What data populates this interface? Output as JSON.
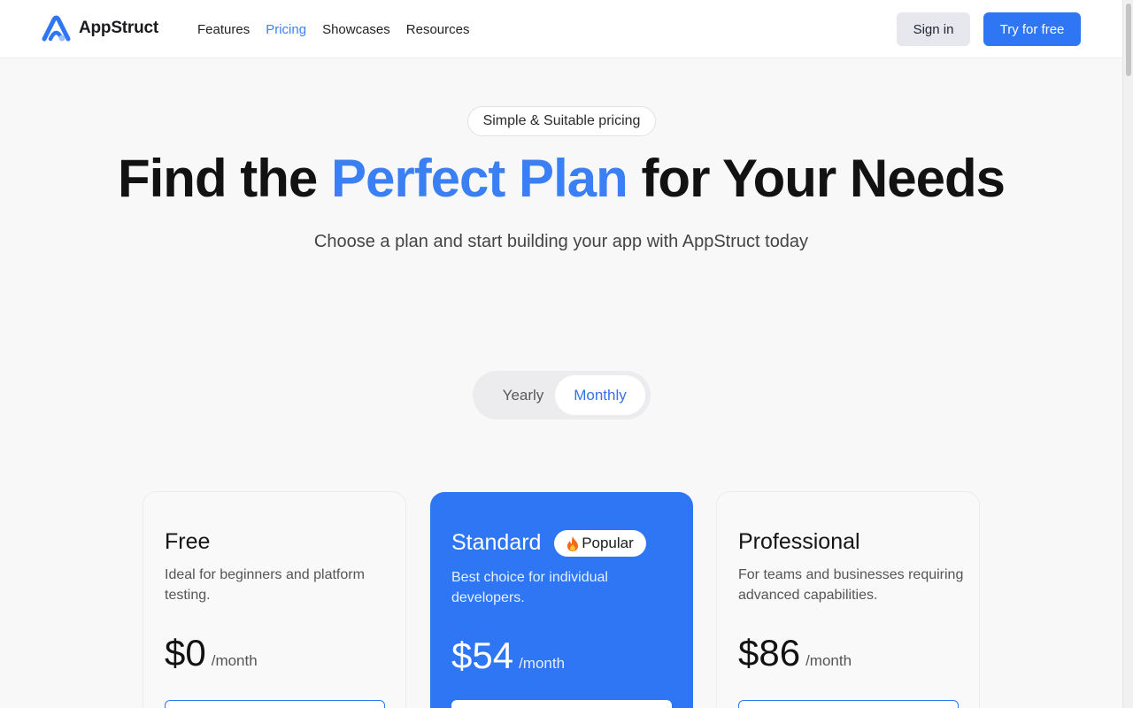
{
  "header": {
    "brand": "AppStruct",
    "nav": [
      {
        "label": "Features"
      },
      {
        "label": "Pricing"
      },
      {
        "label": "Showcases"
      },
      {
        "label": "Resources"
      }
    ],
    "sign_in": "Sign in",
    "try_free": "Try for free"
  },
  "hero": {
    "badge": "Simple & Suitable pricing",
    "title_pre": "Find the ",
    "title_accent": "Perfect Plan",
    "title_post": " for Your Needs",
    "subtitle": "Choose a plan and start building your app with AppStruct today"
  },
  "billing_toggle": {
    "yearly": "Yearly",
    "monthly": "Monthly",
    "selected": "Monthly"
  },
  "plans": [
    {
      "name": "Free",
      "description": "Ideal for beginners and platform testing.",
      "price": "$0",
      "period": "/month"
    },
    {
      "name": "Standard",
      "badge": "Popular",
      "badge_icon": "fire-icon",
      "description": "Best choice for individual developers.",
      "price": "$54",
      "period": "/month"
    },
    {
      "name": "Professional",
      "description": "For teams and businesses requiring advanced capabilities.",
      "price": "$86",
      "period": "/month"
    }
  ],
  "colors": {
    "accent": "#2f76f5",
    "accent_text": "#3a7ff3",
    "background": "#f8f8f9"
  }
}
